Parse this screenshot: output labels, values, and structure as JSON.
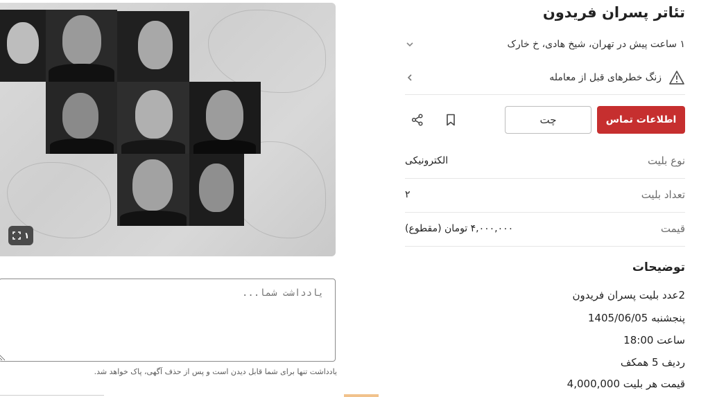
{
  "gallery": {
    "image_count": "۱",
    "expand_icon": "expand-icon"
  },
  "note": {
    "placeholder": "یادداشت شما...",
    "hint": "یادداشت تنها برای شما قابل دیدن است و پس از حذف آگهی، پاک خواهد شد."
  },
  "ad": {
    "title": "تئاتر پسران فریدون",
    "meta": "۱ ساعت پیش در تهران، شیخ هادی، خ خارک",
    "warning": "زنگ خطرهای قبل از معامله"
  },
  "actions": {
    "contact_label": "اطلاعات تماس",
    "chat_label": "چت"
  },
  "info": [
    {
      "label": "نوع بلیت",
      "value": "الکترونیکی"
    },
    {
      "label": "تعداد بلیت",
      "value": "۲"
    },
    {
      "label": "قیمت",
      "value": "۴,۰۰۰,۰۰۰ تومان (مقطوع)"
    }
  ],
  "description": {
    "title": "توضیحات",
    "lines": [
      "2عدد بلیت پسران فریدون",
      "پنجشنبه 1405/06/05",
      "ساعت 18:00",
      "ردیف 5 همکف",
      "قیمت هر بلیت 4,000,000"
    ]
  }
}
